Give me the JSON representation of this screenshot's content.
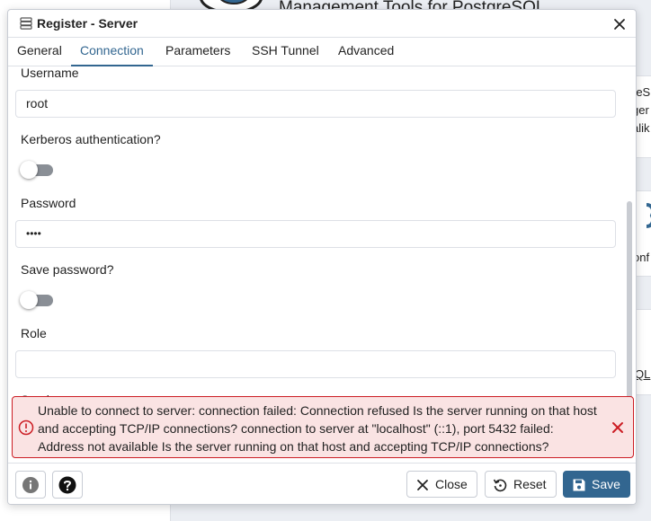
{
  "background": {
    "header_title": "Management Tools for PostgreSQL",
    "card_snippets": [
      "reS",
      "ger",
      "alik",
      "onf",
      "QL"
    ]
  },
  "dialog": {
    "title": "Register - Server",
    "tabs": [
      {
        "label": "General",
        "active": false
      },
      {
        "label": "Connection",
        "active": true
      },
      {
        "label": "Parameters",
        "active": false
      },
      {
        "label": "SSH Tunnel",
        "active": false
      },
      {
        "label": "Advanced",
        "active": false
      }
    ],
    "fields": {
      "username_label": "Username",
      "username_value": "root",
      "kerberos_label": "Kerberos authentication?",
      "kerberos_enabled": false,
      "password_label": "Password",
      "password_value": "••••",
      "save_password_label": "Save password?",
      "save_password_enabled": false,
      "role_label": "Role",
      "role_value": "",
      "cut_off_label": "Service"
    },
    "error": {
      "message": "Unable to connect to server: connection failed: Connection refused Is the server running on that host and accepting TCP/IP connections? connection to server at \"localhost\" (::1), port 5432 failed: Address not available Is the server running on that host and accepting TCP/IP connections?"
    },
    "footer": {
      "info_icon": "info-icon",
      "help_icon": "help-icon",
      "close_label": "Close",
      "reset_label": "Reset",
      "save_label": "Save"
    }
  },
  "colors": {
    "accent": "#326690",
    "error_border": "#cc1d24",
    "error_bg": "#fae3e3"
  }
}
